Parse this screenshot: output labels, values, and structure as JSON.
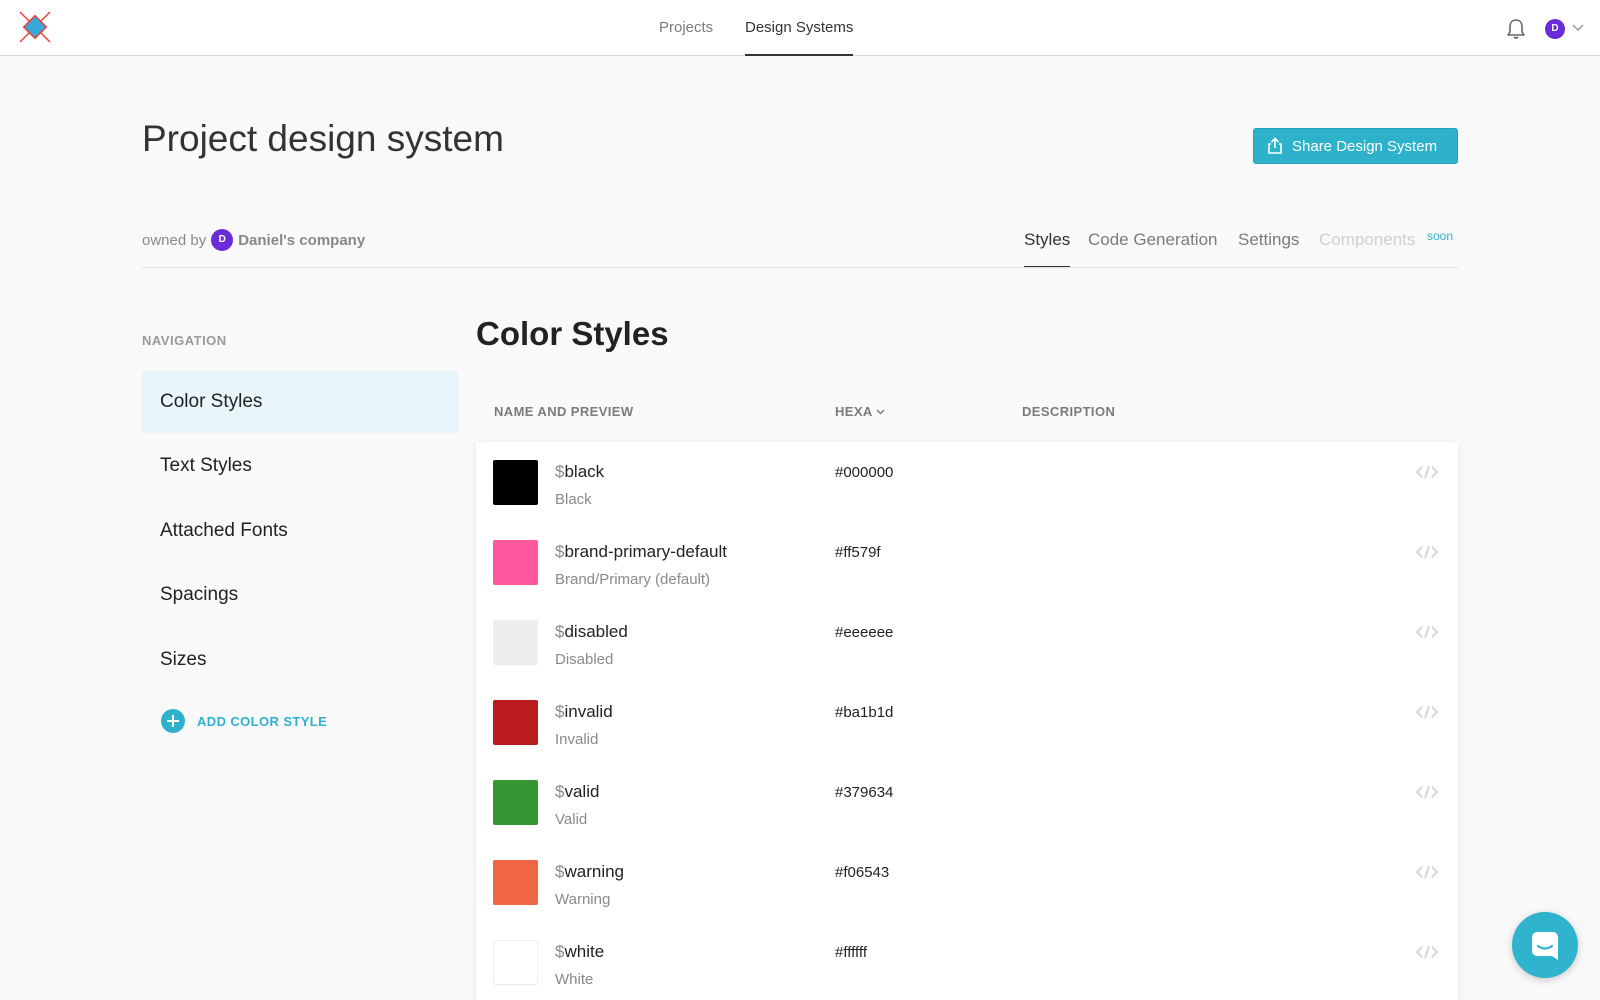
{
  "topnav": {
    "tabs": [
      {
        "label": "Projects",
        "active": false
      },
      {
        "label": "Design Systems",
        "active": true
      }
    ],
    "avatar_initial": "D",
    "bell_icon": "bell-icon"
  },
  "header": {
    "title": "Project design system",
    "share_label": "Share Design System",
    "owned_by": "owned by",
    "owner_initial": "D",
    "owner_name": "Daniel's company"
  },
  "subtabs": [
    {
      "label": "Styles",
      "state": "active"
    },
    {
      "label": "Code Generation",
      "state": "normal"
    },
    {
      "label": "Settings",
      "state": "normal"
    },
    {
      "label": "Components",
      "state": "disabled"
    }
  ],
  "soon_badge": "soon",
  "sidebar": {
    "heading": "NAVIGATION",
    "items": [
      {
        "label": "Color Styles",
        "active": true
      },
      {
        "label": "Text Styles",
        "active": false
      },
      {
        "label": "Attached Fonts",
        "active": false
      },
      {
        "label": "Spacings",
        "active": false
      },
      {
        "label": "Sizes",
        "active": false
      }
    ],
    "add_label": "ADD COLOR STYLE"
  },
  "main": {
    "title": "Color Styles",
    "columns": {
      "name": "NAME AND PREVIEW",
      "hexa": "HEXA",
      "description": "DESCRIPTION"
    },
    "rows": [
      {
        "dollar": "$",
        "var": "black",
        "name": "Black",
        "hex": "#000000",
        "color": "#000000"
      },
      {
        "dollar": "$",
        "var": "brand-primary-default",
        "name": "Brand/Primary (default)",
        "hex": "#ff579f",
        "color": "#ff579f"
      },
      {
        "dollar": "$",
        "var": "disabled",
        "name": "Disabled",
        "hex": "#eeeeee",
        "color": "#eeeeee"
      },
      {
        "dollar": "$",
        "var": "invalid",
        "name": "Invalid",
        "hex": "#ba1b1d",
        "color": "#ba1b1d"
      },
      {
        "dollar": "$",
        "var": "valid",
        "name": "Valid",
        "hex": "#379634",
        "color": "#379634"
      },
      {
        "dollar": "$",
        "var": "warning",
        "name": "Warning",
        "hex": "#f06543",
        "color": "#f06543"
      },
      {
        "dollar": "$",
        "var": "white",
        "name": "White",
        "hex": "#ffffff",
        "color": "#ffffff"
      }
    ]
  },
  "accent_color": "#2eb2cc"
}
